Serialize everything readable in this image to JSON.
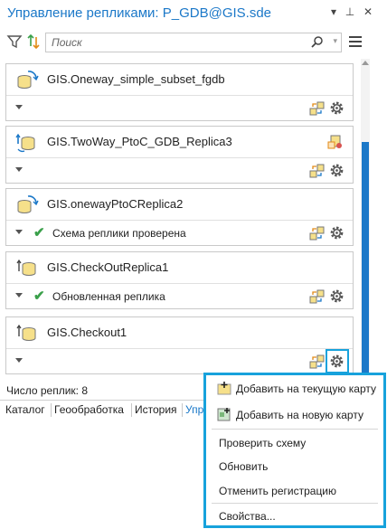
{
  "window": {
    "title": "Управление репликами: P_GDB@GIS.sde",
    "menu_glyph": "▾",
    "pin_glyph": "⊥",
    "close_glyph": "✕"
  },
  "toolbar": {
    "search_placeholder": "Поиск"
  },
  "replicas": [
    {
      "name": "GIS.Oneway_simple_subset_fgdb",
      "status": "",
      "has_check": false,
      "head_icon": false
    },
    {
      "name": "GIS.TwoWay_PtoC_GDB_Replica3",
      "status": "",
      "has_check": false,
      "head_icon": true
    },
    {
      "name": "GIS.onewayPtoCReplica2",
      "status": "Схема реплики проверена",
      "has_check": true,
      "head_icon": false
    },
    {
      "name": "GIS.CheckOutReplica1",
      "status": "Обновленная реплика",
      "has_check": true,
      "head_icon": false
    },
    {
      "name": "GIS.Checkout1",
      "status": "",
      "has_check": false,
      "head_icon": false
    }
  ],
  "check_glyph": "✔",
  "footer": {
    "count_label": "Число реплик: 8"
  },
  "tabs": [
    {
      "label": "Каталог"
    },
    {
      "label": "Геообработка"
    },
    {
      "label": "История"
    },
    {
      "label": "Упр"
    }
  ],
  "context_menu": {
    "items": [
      {
        "label": "Добавить на текущую карту"
      },
      {
        "label": "Добавить на новую карту"
      },
      {
        "label": "Проверить схему"
      },
      {
        "label": "Обновить"
      },
      {
        "label": "Отменить регистрацию"
      },
      {
        "label": "Свойства..."
      }
    ]
  },
  "colors": {
    "accent": "#1b78c8",
    "highlight": "#17a2dc",
    "check": "#3aa04a"
  }
}
